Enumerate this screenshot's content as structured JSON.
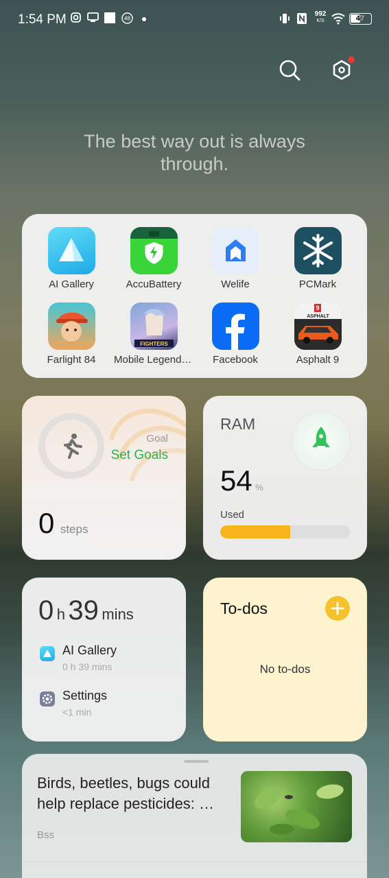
{
  "status_bar": {
    "time": "1:54 PM",
    "net_speed_value": "992",
    "net_speed_unit": "K/S",
    "battery": "47"
  },
  "quote": "The best way out is always through.",
  "apps": [
    {
      "label": "AI Gallery"
    },
    {
      "label": "AccuBattery"
    },
    {
      "label": "Welife"
    },
    {
      "label": "PCMark"
    },
    {
      "label": "Farlight 84"
    },
    {
      "label": "Mobile Legends: Bang Bang"
    },
    {
      "label": "Facebook"
    },
    {
      "label": "Asphalt 9"
    }
  ],
  "steps_widget": {
    "goal_label": "Goal",
    "set_goals": "Set Goals",
    "count": "0",
    "unit": "steps"
  },
  "ram_widget": {
    "title": "RAM",
    "value": "54",
    "unit": "%",
    "used_label": "Used",
    "used_fraction": 0.54
  },
  "screen_time": {
    "hours": "0",
    "hours_unit": "h",
    "minutes": "39",
    "minutes_unit": "mins",
    "apps": [
      {
        "name": "AI Gallery",
        "time": "0 h 39 mins"
      },
      {
        "name": "Settings",
        "time": "<1 min"
      }
    ]
  },
  "todos": {
    "title": "To-dos",
    "empty": "No to-dos"
  },
  "news": {
    "headline": "Birds, beetles, bugs could help replace pesticides: …",
    "source": "Bss"
  },
  "colors": {
    "green_accent": "#2bb24c",
    "ram_bar": "#f7b51c",
    "todo_add": "#f5c22b"
  }
}
